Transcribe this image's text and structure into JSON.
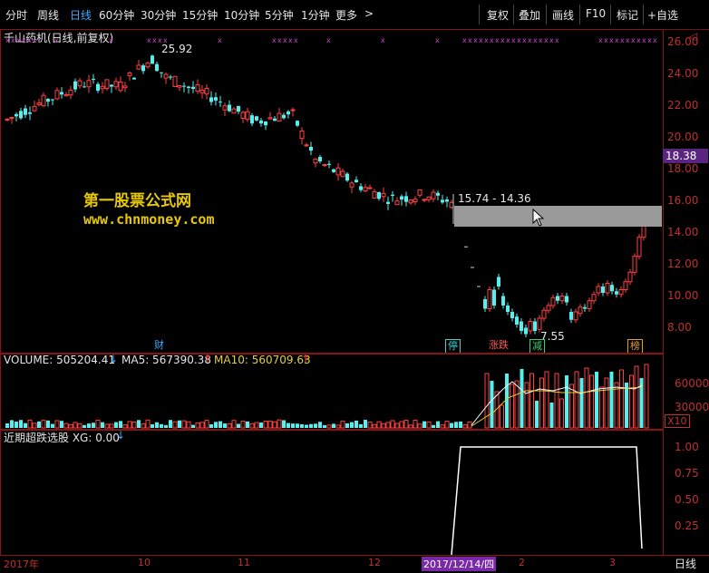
{
  "toolbar": {
    "periods": [
      "分时",
      "周线",
      "日线",
      "60分钟",
      "30分钟",
      "15分钟",
      "10分钟",
      "5分钟",
      "1分钟",
      "更多"
    ],
    "active_period": "日线",
    "more_arrow": ">",
    "buttons": [
      "复权",
      "叠加",
      "画线",
      "F10",
      "标记",
      "+自选"
    ],
    "back_arrow": "◁"
  },
  "main": {
    "title": "千山药机(日线,前复权)",
    "high_label": "25.92",
    "low_label": "7.55",
    "range_label": "15.74 - 14.36",
    "current_price": "18.38",
    "price_axis": [
      "26.00",
      "24.00",
      "22.00",
      "20.00",
      "18.00",
      "16.00",
      "14.00",
      "12.00",
      "10.00",
      "8.00"
    ],
    "markers": [
      {
        "text": "财",
        "color": "#3fa9ff"
      },
      {
        "text": "停",
        "color": "#3fd0d0"
      },
      {
        "text": "涨跌",
        "color": "#ff5a5a"
      },
      {
        "text": "减",
        "color": "#3fd070"
      },
      {
        "text": "榜",
        "color": "#e0a030"
      }
    ]
  },
  "watermark": {
    "line1": "第一股票公式网",
    "line2": "www.chnmoney.com"
  },
  "volume": {
    "label": "VOLUME: 505204.41",
    "ma5": "MA5: 567390.38",
    "ma10": "MA10: 560709.63",
    "axis": [
      "60000",
      "30000"
    ],
    "unit": "X10"
  },
  "indicator": {
    "label": "近期超跌选股 XG: 0.00",
    "axis": [
      "1.00",
      "0.75",
      "0.50",
      "0.25"
    ]
  },
  "dates": {
    "labels": [
      "2017年",
      "10",
      "11",
      "12",
      "2",
      "3"
    ],
    "highlight": "2017/12/14/四",
    "period": "日线"
  },
  "colors": {
    "up": "#ff4040",
    "down": "#54f0f0",
    "border": "#8a1414",
    "highlight": "#7a2aa8"
  }
}
